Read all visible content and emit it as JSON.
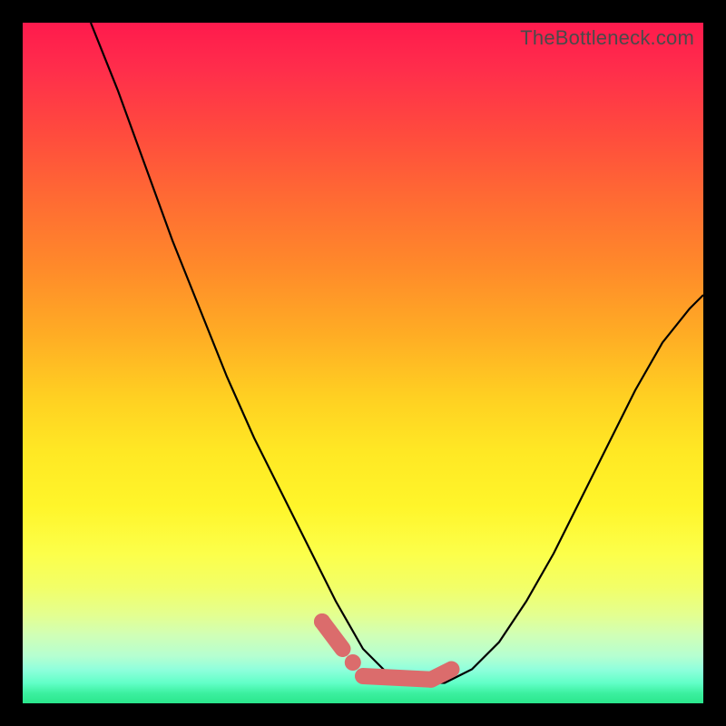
{
  "watermark": "TheBottleneck.com",
  "chart_data": {
    "type": "line",
    "title": "",
    "xlabel": "",
    "ylabel": "",
    "xlim": [
      0,
      100
    ],
    "ylim": [
      0,
      100
    ],
    "note": "Axes are implicit (no tick labels shown). Values are position-percentages within the plot area, read from the image. y=0 is bottom (green), y=100 is top (red). The V-shaped curve's minimum near x≈50 is the low-bottleneck zone highlighted in pink.",
    "series": [
      {
        "name": "bottleneck-curve",
        "x": [
          10,
          14,
          18,
          22,
          26,
          30,
          34,
          38,
          42,
          46,
          50,
          54,
          58,
          62,
          66,
          70,
          74,
          78,
          82,
          86,
          90,
          94,
          98,
          100
        ],
        "y": [
          100,
          90,
          79,
          68,
          58,
          48,
          39,
          31,
          23,
          15,
          8,
          4,
          3,
          3,
          5,
          9,
          15,
          22,
          30,
          38,
          46,
          53,
          58,
          60
        ]
      }
    ],
    "highlight": {
      "name": "optimal-range-marker",
      "color": "#db6c6c",
      "segments": [
        {
          "x": [
            44,
            47
          ],
          "y": [
            12,
            8
          ]
        },
        {
          "x": [
            50,
            60
          ],
          "y": [
            4,
            3.5
          ]
        },
        {
          "x": [
            60,
            63
          ],
          "y": [
            3.5,
            5
          ]
        }
      ],
      "dots": [
        {
          "x": 44,
          "y": 12
        },
        {
          "x": 48.5,
          "y": 6
        }
      ]
    },
    "background_gradient": {
      "orientation": "vertical",
      "stops": [
        {
          "pos": 0,
          "color": "#ff1a4d"
        },
        {
          "pos": 50,
          "color": "#ffcf22"
        },
        {
          "pos": 80,
          "color": "#f8ff55"
        },
        {
          "pos": 100,
          "color": "#2ae68c"
        }
      ]
    }
  }
}
